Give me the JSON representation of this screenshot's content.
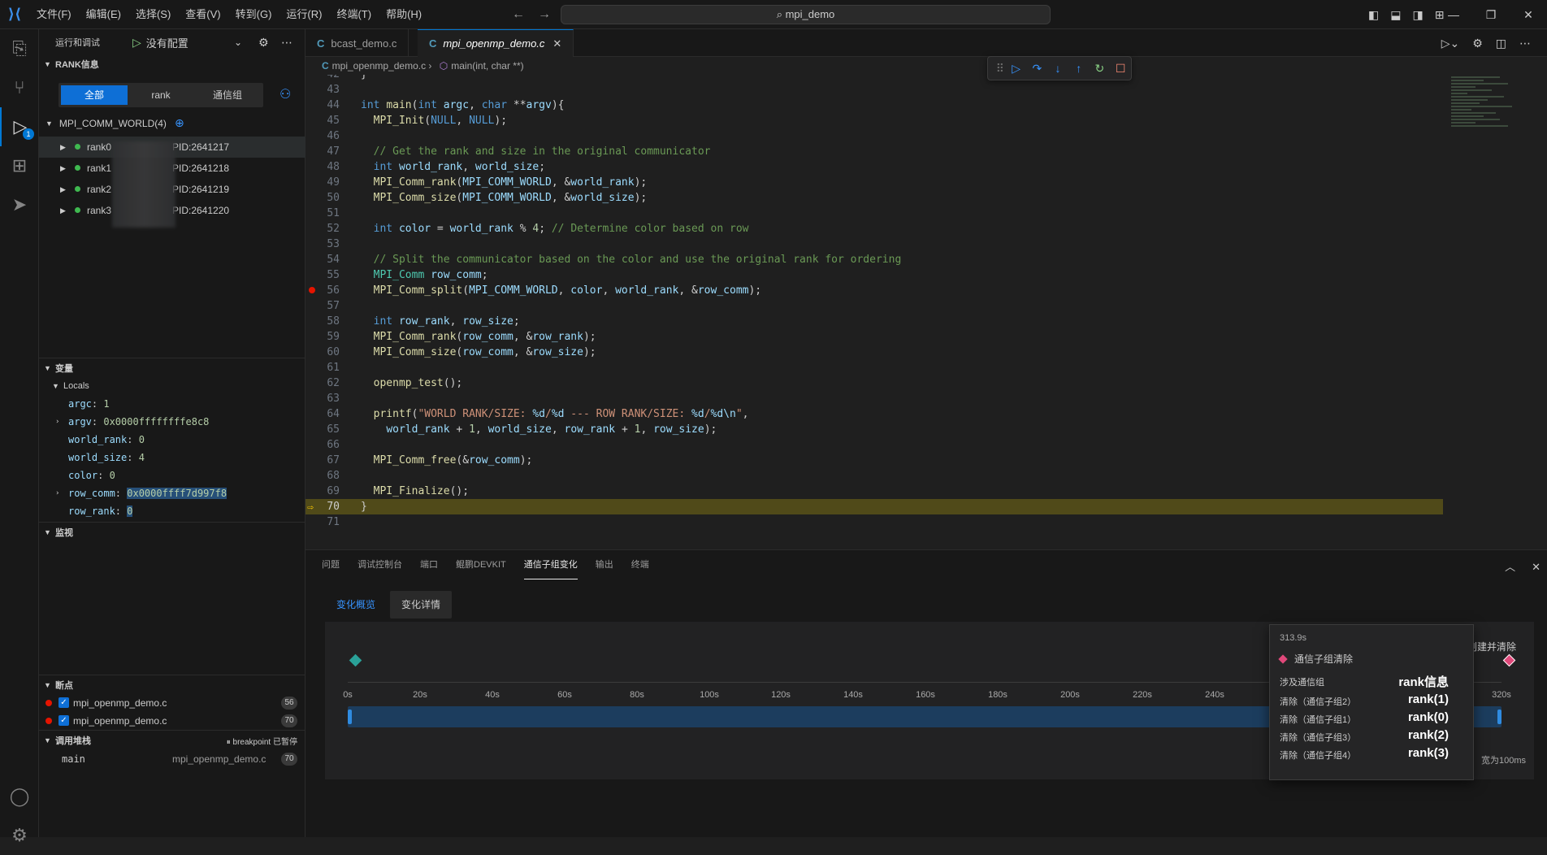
{
  "titlebar": {
    "menu": [
      "文件(F)",
      "编辑(E)",
      "选择(S)",
      "查看(V)",
      "转到(G)",
      "运行(R)",
      "终端(T)",
      "帮助(H)"
    ],
    "search": "mpi_demo"
  },
  "sidebar": {
    "header_label": "运行和调试",
    "config": "没有配置",
    "rank_section": "RANK信息",
    "filters": [
      "全部",
      "rank",
      "通信组"
    ],
    "comm_world": "MPI_COMM_WORLD(4)",
    "ranks": [
      {
        "name": "rank0",
        "pid": "PID:2641217"
      },
      {
        "name": "rank1",
        "pid": "PID:2641218"
      },
      {
        "name": "rank2",
        "pid": "PID:2641219"
      },
      {
        "name": "rank3",
        "pid": "PID:2641220"
      }
    ],
    "variables_section": "变量",
    "locals_label": "Locals",
    "variables": [
      {
        "name": "argc",
        "value": "1"
      },
      {
        "name": "argv",
        "value": "0x0000ffffffffe8c8"
      },
      {
        "name": "world_rank",
        "value": "0"
      },
      {
        "name": "world_size",
        "value": "4"
      },
      {
        "name": "color",
        "value": "0"
      },
      {
        "name": "row_comm",
        "value": "0x0000ffff7d997f8"
      },
      {
        "name": "row_rank",
        "value": "0"
      }
    ],
    "watch_section": "监视",
    "breakpoints_section": "断点",
    "breakpoints": [
      {
        "file": "mpi_openmp_demo.c",
        "line": "56"
      },
      {
        "file": "mpi_openmp_demo.c",
        "line": "70"
      }
    ],
    "callstack_section": "调用堆栈",
    "callstack_status": "breakpoint 已暂停",
    "callstack_frame": {
      "name": "main",
      "file": "mpi_openmp_demo.c",
      "line": "70"
    }
  },
  "editor": {
    "tabs": [
      {
        "label": "bcast_demo.c"
      },
      {
        "label": "mpi_openmp_demo.c"
      }
    ],
    "breadcrumb_file": "mpi_openmp_demo.c",
    "breadcrumb_symbol": "main(int, char **)"
  },
  "panel": {
    "tabs": [
      "问题",
      "调试控制台",
      "端口",
      "鲲鹏DEVKIT",
      "通信子组变化",
      "输出",
      "终端"
    ],
    "subtabs": [
      "变化概览",
      "变化详情"
    ],
    "ticks": [
      "0s",
      "20s",
      "40s",
      "60s",
      "80s",
      "100s",
      "120s",
      "140s",
      "160s",
      "180s",
      "200s",
      "220s",
      "240s",
      "320s"
    ],
    "right_label": "创建并清除",
    "note": "宽为100ms",
    "tooltip": {
      "time": "313.9s",
      "event": "通信子组清除",
      "rows": [
        {
          "left": "涉及通信组",
          "right": "rank信息"
        },
        {
          "left": "清除（通信子组2）",
          "right": "rank(1)"
        },
        {
          "left": "清除（通信子组1）",
          "right": "rank(0)"
        },
        {
          "left": "清除（通信子组3）",
          "right": "rank(2)"
        },
        {
          "left": "清除（通信子组4）",
          "right": "rank(3)"
        }
      ]
    }
  }
}
